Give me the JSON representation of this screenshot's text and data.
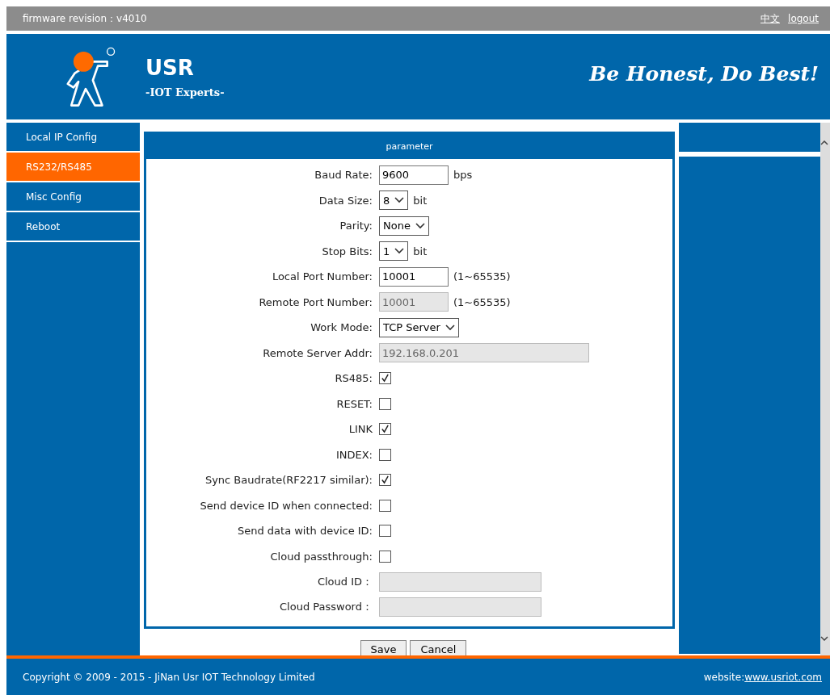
{
  "top_bar": {
    "firmware": "firmware revision：v4010",
    "links": [
      "中文",
      "logout"
    ]
  },
  "header": {
    "brand": "USR",
    "subtitle": "-IOT Experts-",
    "slogan": "Be Honest, Do Best!"
  },
  "sidebar": {
    "items": [
      {
        "label": "Local IP Config",
        "selected": false
      },
      {
        "label": "RS232/RS485",
        "selected": true
      },
      {
        "label": "Misc Config",
        "selected": false
      },
      {
        "label": "Reboot",
        "selected": false
      }
    ]
  },
  "panel": {
    "title": "parameter",
    "fields": [
      {
        "kind": "text",
        "label": "Baud Rate:",
        "value": "9600",
        "unit": "bps",
        "disabled": false
      },
      {
        "kind": "select",
        "label": "Data Size:",
        "value": "8",
        "unit": "bit",
        "disabled": false
      },
      {
        "kind": "select",
        "label": "Parity:",
        "value": "None",
        "disabled": false
      },
      {
        "kind": "select",
        "label": "Stop Bits:",
        "value": "1",
        "unit": "bit",
        "disabled": false
      },
      {
        "kind": "text",
        "label": "Local Port Number:",
        "value": "10001",
        "unit": "(1~65535)",
        "disabled": false
      },
      {
        "kind": "text",
        "label": "Remote Port Number:",
        "value": "10001",
        "unit": "(1~65535)",
        "disabled": true
      },
      {
        "kind": "select",
        "label": "Work Mode:",
        "value": "TCP Server",
        "disabled": false
      },
      {
        "kind": "wide_text",
        "label": "Remote Server Addr:",
        "value": "192.168.0.201",
        "disabled": true
      },
      {
        "kind": "checkbox",
        "label": "RS485:",
        "checked": true
      },
      {
        "kind": "checkbox",
        "label": "RESET:",
        "checked": false
      },
      {
        "kind": "checkbox",
        "label": "LINK",
        "checked": true
      },
      {
        "kind": "checkbox",
        "label": "INDEX:",
        "checked": false
      },
      {
        "kind": "checkbox",
        "label": "Sync Baudrate(RF2217 similar):",
        "checked": true
      },
      {
        "kind": "checkbox",
        "label": "Send device ID when connected:",
        "checked": false
      },
      {
        "kind": "checkbox",
        "label": "Send data with device ID:",
        "checked": false
      },
      {
        "kind": "checkbox",
        "label": "Cloud passthrough:",
        "checked": false
      },
      {
        "kind": "mid_text",
        "label": "Cloud ID：",
        "disabled": true
      },
      {
        "kind": "mid_text",
        "label": "Cloud Password：",
        "disabled": true
      }
    ],
    "buttons": [
      "Save",
      "Cancel"
    ]
  },
  "footer": {
    "copyright": "Copyright © 2009 - 2015 - JiNan Usr IOT Technology Limited",
    "website_label": "website:",
    "website_link": "www.usriot.com"
  }
}
